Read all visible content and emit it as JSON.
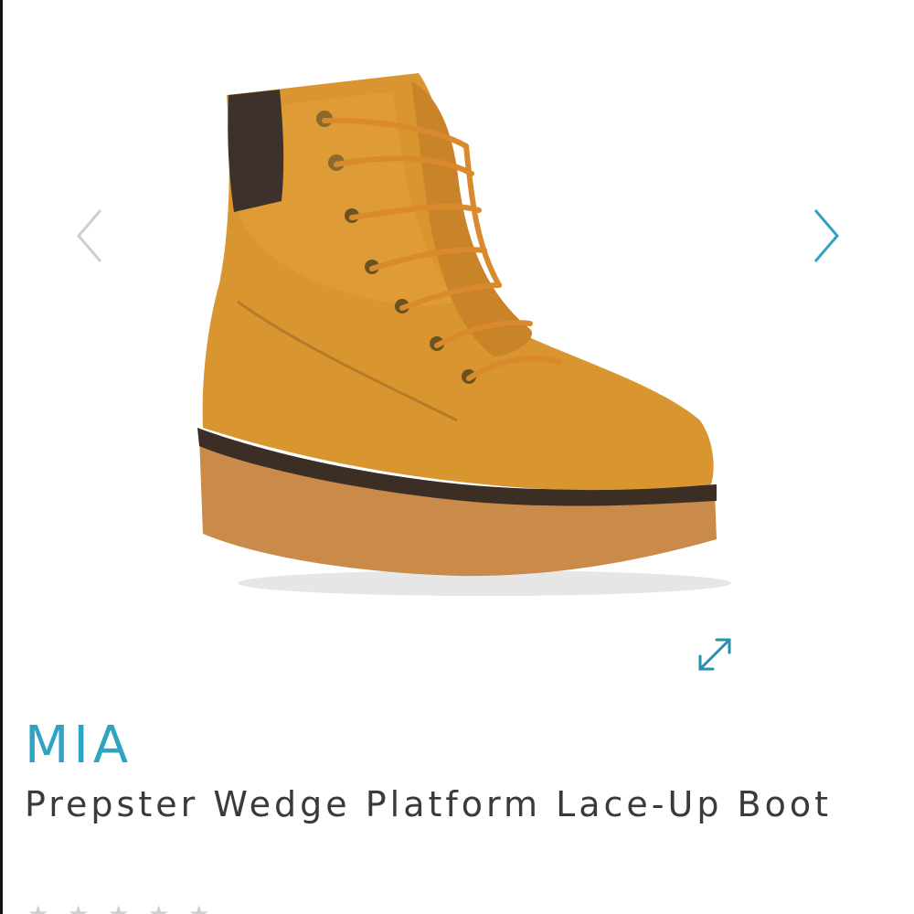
{
  "product": {
    "brand": "MIA",
    "title": "Prepster Wedge Platform Lace-Up Boot",
    "image_subject": "tan lace-up wedge platform boot"
  },
  "gallery": {
    "prev_icon": "chevron-left-icon",
    "next_icon": "chevron-right-icon",
    "expand_icon": "expand-icon"
  },
  "colors": {
    "accent": "#2fa3c2",
    "title_text": "#3a3a3a",
    "disabled_arrow": "#c8d0d4",
    "star_empty": "#cfcfcf"
  },
  "rating": {
    "stars_filled": 0,
    "stars_total": 5
  }
}
